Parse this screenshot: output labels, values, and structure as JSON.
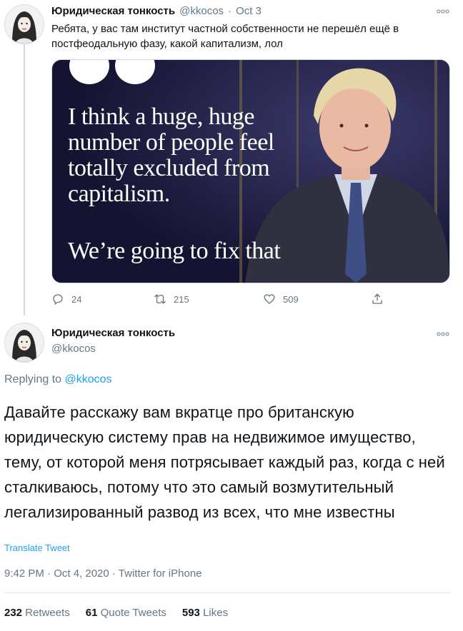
{
  "tweet1": {
    "display_name": "Юридическая тонкость",
    "handle": "@kkocos",
    "separator": "·",
    "date": "Oct 3",
    "text": "Ребята, у вас там институт частной собственности не перешёл ещё в постфеодальную фазу, какой капитализм, лол",
    "media": {
      "quote_line1": "I think a huge, huge",
      "quote_line2": "number of people feel",
      "quote_line3": "totally excluded from",
      "quote_line4": "capitalism.",
      "quote_line5": "We’re going to fix that"
    },
    "actions": {
      "reply_count": "24",
      "retweet_count": "215",
      "like_count": "509"
    },
    "icons": [
      "reply-icon",
      "retweet-icon",
      "like-icon",
      "share-icon",
      "more-icon"
    ]
  },
  "tweet2": {
    "display_name": "Юридическая тонкость",
    "handle": "@kkocos",
    "replying_prefix": "Replying to",
    "replying_handle": "@kkocos",
    "text": "Давайте расскажу вам вкратце про британскую юридическую систему прав на недвижимое имущество, тему, от которой меня потрясывает каждый раз, когда с ней сталкиваюсь, потому что это самый возмутительный легализированный развод из всех, что мне известны",
    "translate_label": "Translate Tweet",
    "meta": "9:42 PM · Oct 4, 2020 · Twitter for iPhone",
    "stats": {
      "retweets_count": "232",
      "retweets_label": "Retweets",
      "quotes_count": "61",
      "quotes_label": "Quote Tweets",
      "likes_count": "593",
      "likes_label": "Likes"
    }
  },
  "colors": {
    "accent": "#1da1f2",
    "secondary_text": "#657786",
    "primary_text": "#0f1419",
    "media_bg": "#1b1a3e"
  }
}
